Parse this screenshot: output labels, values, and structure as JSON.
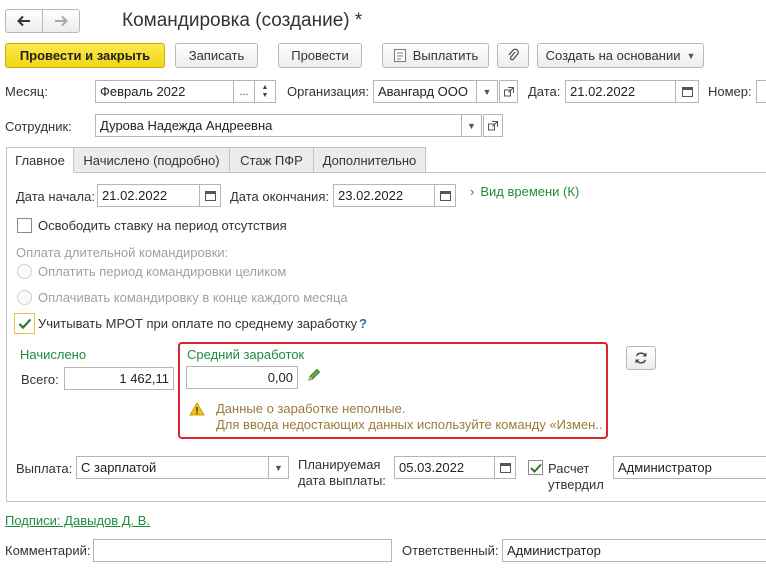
{
  "window": {
    "title": "Командировка (создание) *"
  },
  "nav": {
    "back_icon": "arrow-left-icon",
    "forward_icon": "arrow-right-icon"
  },
  "toolbar": {
    "post_close": "Провести и закрыть",
    "save": "Записать",
    "post": "Провести",
    "pay": "Выплатить",
    "create_based": "Создать на основании"
  },
  "header": {
    "month_label": "Месяц:",
    "month_value": "Февраль 2022",
    "month_ellipsis": "...",
    "org_label": "Организация:",
    "org_value": "Авангард ООО",
    "date_label": "Дата:",
    "date_value": "21.02.2022",
    "number_label": "Номер:",
    "employee_label": "Сотрудник:",
    "employee_value": "Дурова Надежда Андреевна"
  },
  "tabs": [
    {
      "label": "Главное",
      "active": true
    },
    {
      "label": "Начислено (подробно)"
    },
    {
      "label": "Стаж ПФР"
    },
    {
      "label": "Дополнительно"
    }
  ],
  "main": {
    "start_label": "Дата начала:",
    "start_value": "21.02.2022",
    "end_label": "Дата окончания:",
    "end_value": "23.02.2022",
    "time_type_link": "Вид времени (К)",
    "free_rate_label": "Освободить ставку на период отсутствия",
    "long_trip_label": "Оплата длительной командировки:",
    "radio_whole": "Оплатить период командировки целиком",
    "radio_monthly": "Оплачивать командировку в конце каждого месяца",
    "mrot_label": "Учитывать МРОТ при оплате по среднему заработку",
    "mrot_help": "?",
    "accrued_title": "Начислено",
    "total_label": "Всего:",
    "total_value": "1 462,11",
    "avg_title": "Средний заработок",
    "avg_value": "0,00",
    "warn_line1": "Данные о заработке неполные.",
    "warn_line2": "Для ввода недостающих данных используйте команду «Измен...",
    "payout_label": "Выплата:",
    "payout_value": "С зарплатой",
    "planned_label_1": "Планируемая",
    "planned_label_2": "дата выплаты:",
    "planned_value": "05.03.2022",
    "approved_label_1": "Расчет",
    "approved_label_2": "утвердил",
    "approved_value": "Администратор"
  },
  "footer": {
    "signatures_link": "Подписи: Давыдов Д. В.",
    "comment_label": "Комментарий:",
    "comment_value": "",
    "responsible_label": "Ответственный:",
    "responsible_value": "Администратор"
  },
  "colors": {
    "primary_button": "#f2d616",
    "green_text": "#1f8c3c",
    "alert_border": "#d9262b",
    "warning_text": "#9a7b3a"
  }
}
